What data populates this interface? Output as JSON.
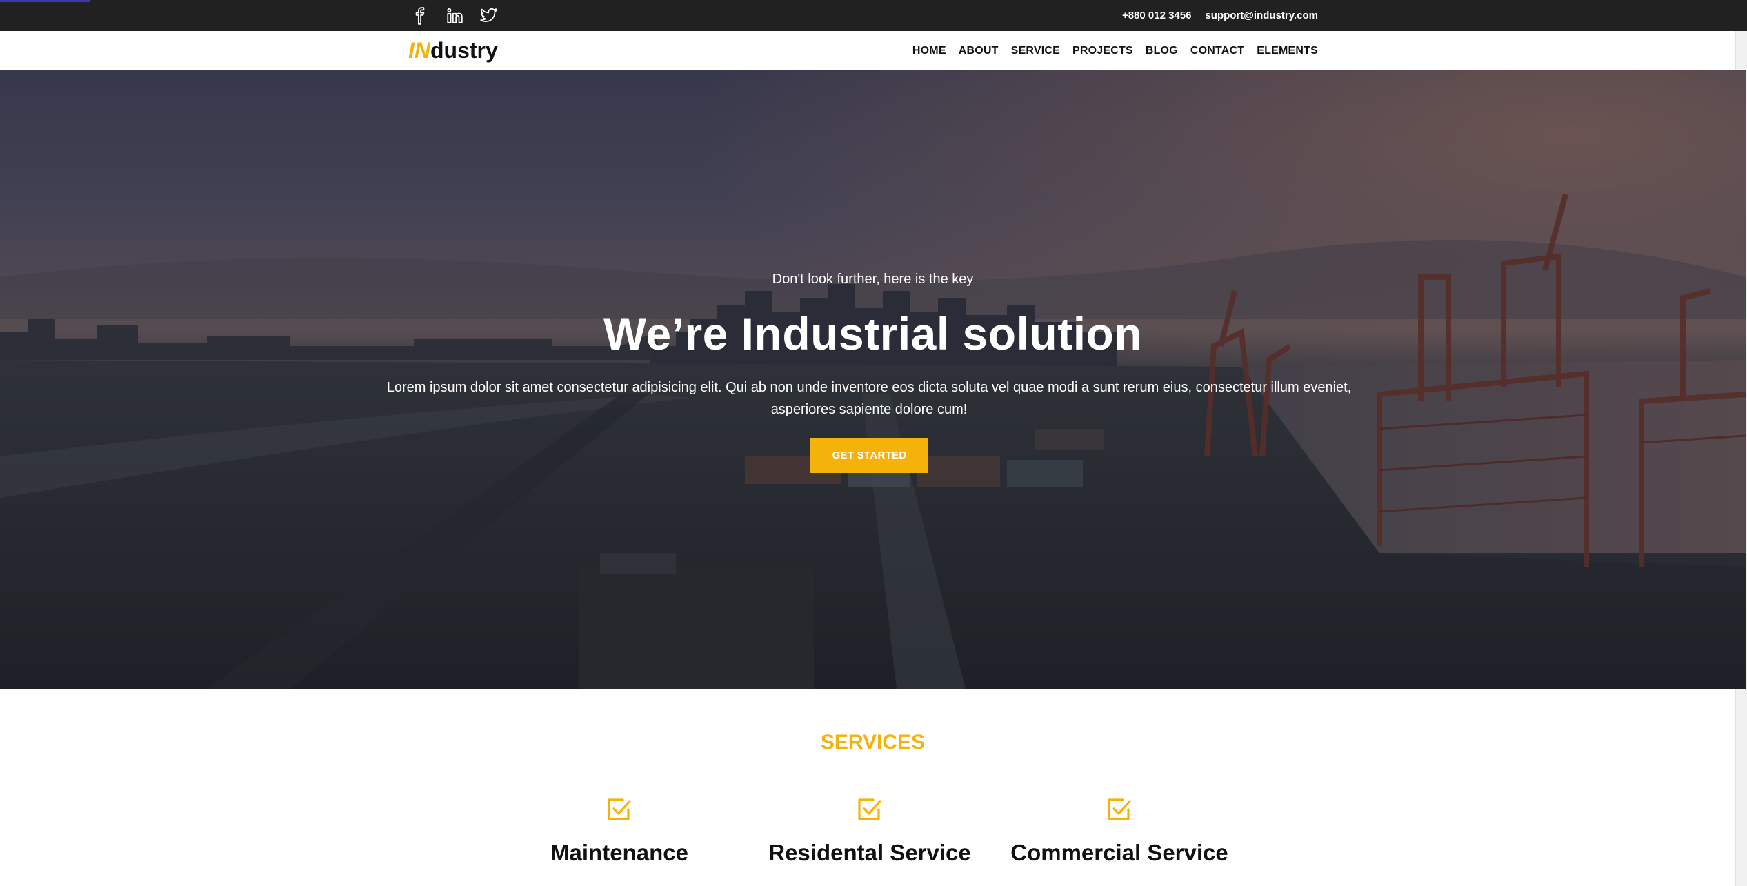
{
  "topbar": {
    "social": [
      {
        "icon": "facebook-icon"
      },
      {
        "icon": "linkedin-icon"
      },
      {
        "icon": "twitter-icon"
      }
    ],
    "phone": "+880 012 3456",
    "email": "support@industry.com"
  },
  "logo": {
    "accent": "IN",
    "rest": "dustry"
  },
  "nav": {
    "items": [
      "HOME",
      "ABOUT",
      "SERVICE",
      "PROJECTS",
      "BLOG",
      "CONTACT",
      "ELEMENTS"
    ]
  },
  "hero": {
    "kicker": "Don't look further, here is the key",
    "title": "We’re Industrial solution",
    "body": "Lorem ipsum dolor sit amet consectetur adipisicing elit. Qui ab non unde inventore eos dicta soluta vel quae modi a sunt rerum eius, consectetur illum eveniet, asperiores sapiente dolore cum!",
    "cta": "GET STARTED",
    "background_image": "industrial port with cranes and container yard at dusk"
  },
  "services": {
    "heading": "SERVICES",
    "items": [
      {
        "icon": "checkbox-icon",
        "name": "Maintenance"
      },
      {
        "icon": "checkbox-icon",
        "name": "Residental Service"
      },
      {
        "icon": "checkbox-icon",
        "name": "Commercial Service"
      }
    ]
  },
  "colors": {
    "accent": "#f5b20a",
    "topbar": "#212121",
    "text_dark": "#111111"
  }
}
